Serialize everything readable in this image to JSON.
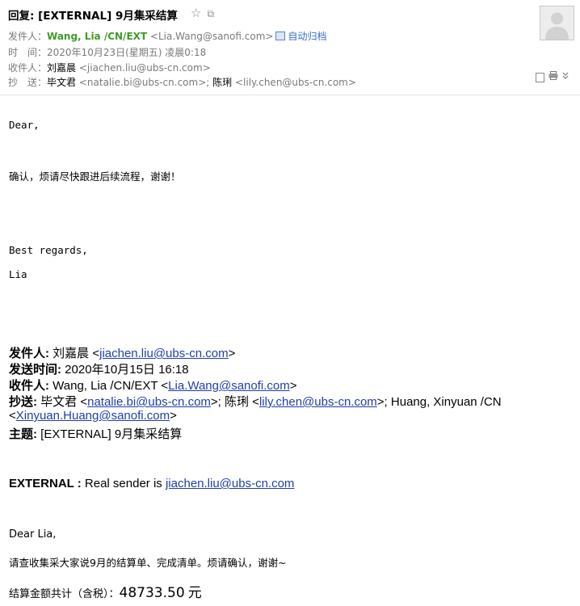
{
  "header": {
    "subject": "回复: [EXTERNAL] 9月集采结算",
    "icons": [
      "star-icon",
      "popout-icon"
    ],
    "from_label": "发件人：",
    "from_name": "Wang, Lia /CN/EXT",
    "from_email": "<Lia.Wang@sanofi.com>",
    "auto_archive": "自动归档",
    "time_label": "时　间：",
    "time_value": "2020年10月23日(星期五) 凌晨0:18",
    "to_label": "收件人：",
    "to_name": "刘嘉晨",
    "to_email": "<jiachen.liu@ubs-cn.com>",
    "cc_label": "抄　送：",
    "cc1_name": "毕文君",
    "cc1_email": "<natalie.bi@ubs-cn.com>;",
    "cc2_name": "陈琍",
    "cc2_email": "<lily.chen@ubs-cn.com>",
    "tool_icons": [
      "note-icon",
      "print-icon",
      "more-chevron-icon"
    ]
  },
  "reply": {
    "greeting": "Dear,",
    "line1": "确认，烦请尽快跟进后续流程，谢谢！",
    "regards": "Best regards,",
    "signature": "Lia"
  },
  "quoted": {
    "from_label": "发件人:",
    "from_name": "刘嘉晨 <",
    "from_email": "jiachen.liu@ubs-cn.com",
    "from_close": ">",
    "sent_label": "发送时间:",
    "sent_value": "2020年10月15日 16:18",
    "to_label": "收件人:",
    "to_name": "Wang, Lia /CN/EXT <",
    "to_email": "Lia.Wang@sanofi.com",
    "to_close": ">",
    "cc_label": "抄送:",
    "cc1_name": "毕文君 <",
    "cc1_email": "natalie.bi@ubs-cn.com",
    "cc1_sep": ">; 陈琍 <",
    "cc2_email": "lily.chen@ubs-cn.com",
    "cc2_sep": ">; Huang, Xinyuan /CN",
    "cc3_open": "<",
    "cc3_email": "Xinyuan.Huang@sanofi.com",
    "cc3_close": ">",
    "subject_label": "主题:",
    "subject_value": "[EXTERNAL] 9月集采结算",
    "external_label": "EXTERNAL :",
    "external_text": "Real sender is",
    "external_email": "jiachen.liu@ubs-cn.com",
    "greeting": "Dear Lia,",
    "body1": "请查收集采大家说9月的结算单、完成清单。烦请确认，谢谢~",
    "total_label": "结算金额共计（含税）：",
    "total_amount": "48733.50",
    "total_unit": "元"
  }
}
